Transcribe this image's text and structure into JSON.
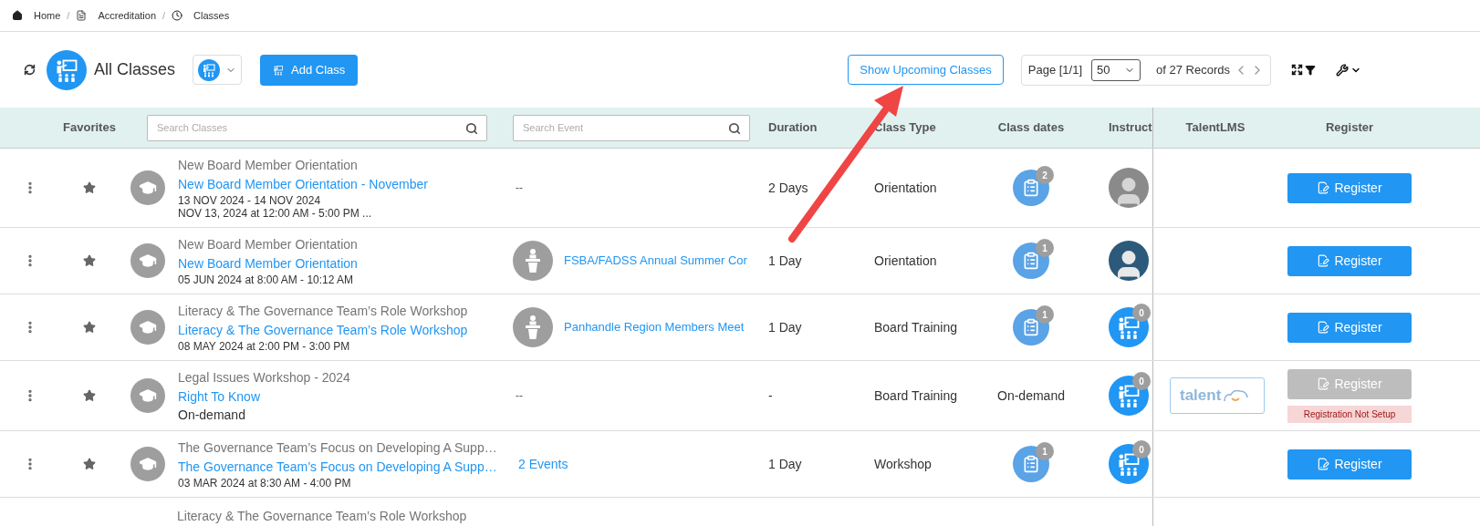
{
  "breadcrumb_separator": "/",
  "breadcrumb": [
    {
      "label": "Home",
      "kind": "home"
    },
    {
      "label": "Accreditation",
      "kind": "doc"
    },
    {
      "label": "Classes",
      "kind": "clock"
    }
  ],
  "toolbar": {
    "title": "All Classes",
    "add_button": "Add Class",
    "upcoming_button": "Show Upcoming Classes",
    "page_label": "Page [1/1]",
    "page_size": "50",
    "records": "of 27 Records"
  },
  "table": {
    "columns": {
      "favorites": "Favorites",
      "class_search": {
        "placeholder": "Search Classes"
      },
      "event_search": {
        "placeholder": "Search Event"
      },
      "duration": "Duration",
      "class_type": "Class Type",
      "class_dates": "Class dates",
      "instructor": "Instruct",
      "talentlms": "TalentLMS",
      "register": "Register"
    },
    "rows": [
      {
        "category": "New Board Member Orientation",
        "title": "New Board Member Orientation - November",
        "details": [
          "13 NOV 2024 - 14 NOV 2024",
          "NOV 13, 2024 at 12:00 AM - 5:00 PM ..."
        ],
        "event": {
          "kind": "none",
          "text": "--"
        },
        "duration": "2 Days",
        "class_type": "Orientation",
        "class_dates": {
          "kind": "icon",
          "count": "2"
        },
        "instructor": {
          "kind": "silhouette"
        },
        "talentlms": null,
        "register": {
          "label": "Register",
          "disabled": false
        }
      },
      {
        "category": "New Board Member Orientation",
        "title": "New Board Member Orientation",
        "details": [
          "05 JUN 2024 at 8:00 AM - 10:12 AM"
        ],
        "event": {
          "kind": "single",
          "text": "FSBA/FADSS Annual Summer Cor"
        },
        "duration": "1 Day",
        "class_type": "Orientation",
        "class_dates": {
          "kind": "icon",
          "count": "1"
        },
        "instructor": {
          "kind": "avatar"
        },
        "talentlms": null,
        "register": {
          "label": "Register",
          "disabled": false
        }
      },
      {
        "category": "Literacy & The Governance Team’s Role Workshop",
        "title": "Literacy & The Governance Team’s Role Workshop",
        "details": [
          "08 MAY 2024 at 2:00 PM - 3:00 PM"
        ],
        "event": {
          "kind": "single",
          "text": "Panhandle Region Members Meet"
        },
        "duration": "1 Day",
        "class_type": "Board Training",
        "class_dates": {
          "kind": "icon",
          "count": "1"
        },
        "instructor": {
          "kind": "presenter",
          "badge": "0"
        },
        "talentlms": null,
        "register": {
          "label": "Register",
          "disabled": false
        }
      },
      {
        "category": "Legal Issues Workshop - 2024",
        "title": "Right To Know",
        "details": [
          "On-demand"
        ],
        "event": {
          "kind": "none",
          "text": "--"
        },
        "duration": "-",
        "class_type": "Board Training",
        "class_dates": {
          "kind": "text",
          "text": "On-demand"
        },
        "instructor": {
          "kind": "presenter",
          "badge": "0"
        },
        "talentlms": {
          "logo": "talent"
        },
        "register": {
          "label": "Register",
          "disabled": true,
          "note": "Registration Not Setup"
        }
      },
      {
        "category": "The Governance Team’s Focus on Developing A Supp…",
        "title": "The Governance Team’s Focus on Developing A Supp…",
        "details": [
          "03 MAR 2024 at 8:30 AM - 4:00 PM"
        ],
        "event": {
          "kind": "count",
          "text": "2 Events"
        },
        "duration": "1 Day",
        "class_type": "Workshop",
        "class_dates": {
          "kind": "icon",
          "count": "1"
        },
        "instructor": {
          "kind": "presenter",
          "badge": "0"
        },
        "talentlms": null,
        "register": {
          "label": "Register",
          "disabled": false
        }
      },
      {
        "category": "Literacy & The Governance Team’s Role Workshop"
      }
    ]
  }
}
